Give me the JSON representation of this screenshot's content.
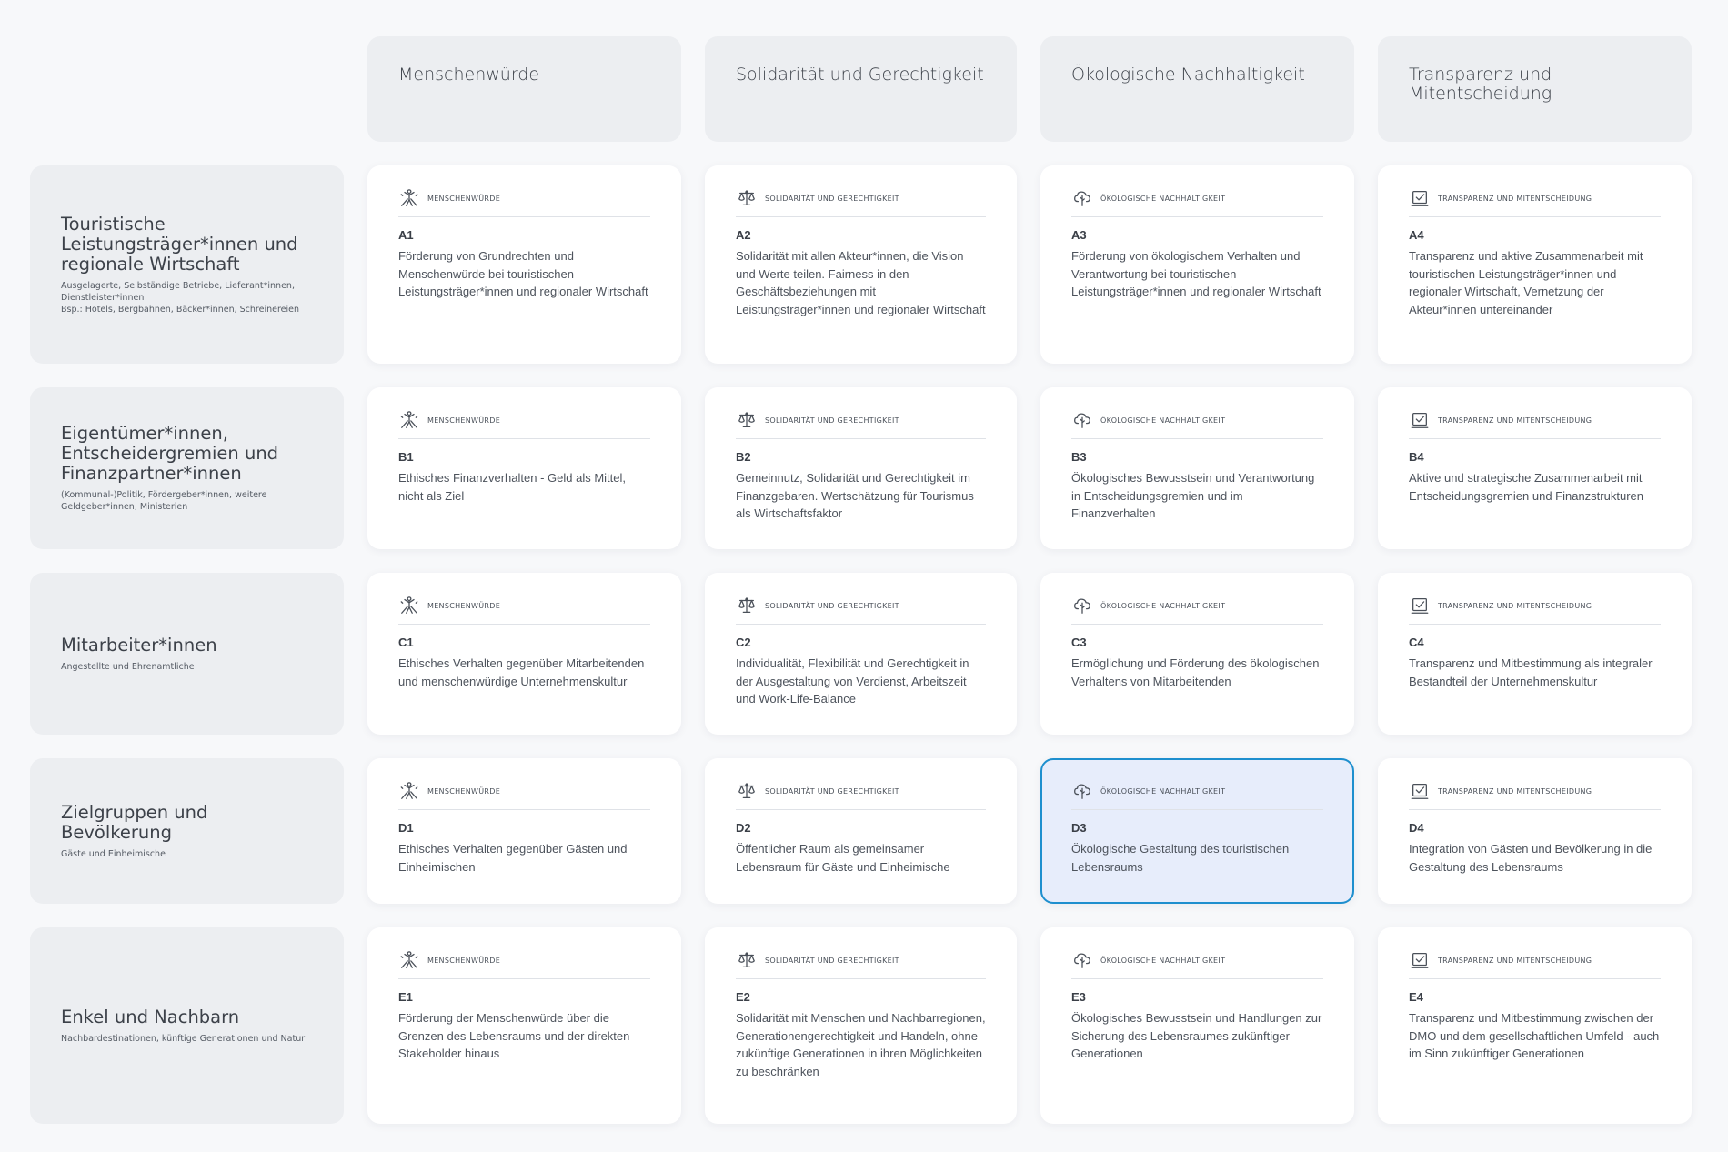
{
  "columns": [
    {
      "label": "Menschenwürde",
      "category": "Menschenwürde",
      "icon": "human-dignity-icon"
    },
    {
      "label": "Solidarität und Gerechtigkeit",
      "category": "Solidarität und Gerechtigkeit",
      "icon": "scales-icon"
    },
    {
      "label": "Ökologische Nachhaltigkeit",
      "category": "Ökologische Nachhaltigkeit",
      "icon": "tree-cloud-icon"
    },
    {
      "label": "Transparenz und Mitentscheidung",
      "category": "Transparenz und Mitentscheidung",
      "icon": "checkbox-icon"
    }
  ],
  "rows": [
    {
      "title": "Touristische Leistungsträger*innen und regionale Wirtschaft",
      "subtitle": "Ausgelagerte, Selbständige Betriebe, Lieferant*innen, Dienstleister*innen\nBsp.: Hotels, Bergbahnen, Bäcker*innen, Schreinereien",
      "cells": [
        {
          "code": "A1",
          "text": "Förderung von Grundrechten und Menschenwürde bei touristischen Leistungsträger*innen und regionaler Wirtschaft"
        },
        {
          "code": "A2",
          "text": "Solidarität mit allen Akteur*innen, die Vision und Werte teilen. Fairness in den Geschäftsbeziehungen mit Leistungsträger*innen und regionaler Wirtschaft"
        },
        {
          "code": "A3",
          "text": "Förderung von ökologischem Verhalten und Verantwortung bei touristischen Leistungsträger*innen und regionaler Wirtschaft"
        },
        {
          "code": "A4",
          "text": "Transparenz und aktive Zusammenarbeit mit touristischen Leistungsträger*innen und regionaler Wirtschaft, Vernetzung der Akteur*innen untereinander"
        }
      ]
    },
    {
      "title": "Eigentümer*innen, Entscheidergremien und Finanzpartner*innen",
      "subtitle": "(Kommunal-)Politik, Fördergeber*innen, weitere Geldgeber*innen, Ministerien",
      "cells": [
        {
          "code": "B1",
          "text": "Ethisches Finanzverhalten - Geld als Mittel, nicht als Ziel"
        },
        {
          "code": "B2",
          "text": "Gemeinnutz, Solidarität und Gerechtigkeit im Finanzgebaren. Wertschätzung für Tourismus als Wirtschaftsfaktor"
        },
        {
          "code": "B3",
          "text": "Ökologisches Bewusstsein und Verantwortung in Entscheidungsgremien und im Finanzverhalten"
        },
        {
          "code": "B4",
          "text": "Aktive und strategische Zusammenarbeit mit Entscheidungsgremien und Finanzstrukturen"
        }
      ]
    },
    {
      "title": "Mitarbeiter*innen",
      "subtitle": "Angestellte und Ehrenamtliche",
      "cells": [
        {
          "code": "C1",
          "text": "Ethisches Verhalten gegenüber Mitarbeitenden und menschenwürdige Unternehmenskultur"
        },
        {
          "code": "C2",
          "text": "Individualität, Flexibilität und Gerechtigkeit in der Ausgestaltung von Verdienst, Arbeitszeit und Work-Life-Balance"
        },
        {
          "code": "C3",
          "text": "Ermöglichung und Förderung des ökologischen Verhaltens von Mitarbeitenden"
        },
        {
          "code": "C4",
          "text": "Transparenz und Mitbestimmung als integraler Bestandteil der Unternehmenskultur"
        }
      ]
    },
    {
      "title": "Zielgruppen und Bevölkerung",
      "subtitle": "Gäste und Einheimische",
      "cells": [
        {
          "code": "D1",
          "text": "Ethisches Verhalten gegenüber Gästen und Einheimischen"
        },
        {
          "code": "D2",
          "text": "Öffentlicher Raum als gemeinsamer Lebensraum für Gäste und Einheimische"
        },
        {
          "code": "D3",
          "text": "Ökologische Gestaltung des touristischen Lebensraums",
          "selected": true
        },
        {
          "code": "D4",
          "text": "Integration von Gästen und Bevölkerung in die Gestaltung des Lebensraums"
        }
      ]
    },
    {
      "title": "Enkel und Nachbarn",
      "subtitle": "Nachbardestinationen, künftige Generationen und Natur",
      "cells": [
        {
          "code": "E1",
          "text": "Förderung der Menschenwürde über die Grenzen des Lebensraums und der direkten Stakeholder hinaus"
        },
        {
          "code": "E2",
          "text": "Solidarität mit Menschen und Nachbarregionen, Generationengerechtigkeit und Handeln, ohne zukünftige Generationen in ihren Möglichkeiten zu beschränken"
        },
        {
          "code": "E3",
          "text": "Ökologisches Bewusstsein und Handlungen zur Sicherung des Lebensraumes zukünftiger Generationen"
        },
        {
          "code": "E4",
          "text": "Transparenz und Mitbestimmung zwischen der DMO und dem gesellschaftlichen Umfeld - auch im Sinn zukünftiger Generationen"
        }
      ]
    }
  ],
  "colors": {
    "background": "#f7f8fa",
    "header_bg": "#eceef1",
    "card_bg": "#ffffff",
    "selected_bg": "#e7edfb",
    "selected_border": "#1e8fce"
  }
}
